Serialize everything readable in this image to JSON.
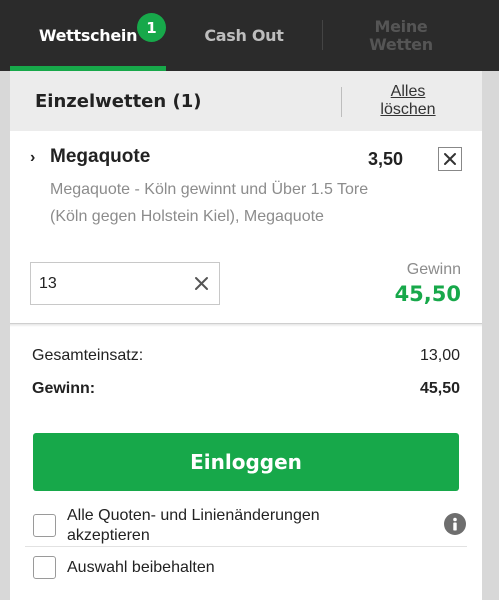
{
  "tabs": {
    "betslip": {
      "label": "Wettschein",
      "badge": "1",
      "active": true
    },
    "cashout": {
      "label": "Cash Out"
    },
    "mybets": {
      "label": "Meine\nWetten"
    }
  },
  "section": {
    "title": "Einzelwetten (1)",
    "clear_all": "Alles\nlöschen"
  },
  "bet": {
    "name": "Megaquote",
    "odds": "3,50",
    "description": "Megaquote - Köln gewinnt und Über 1.5 Tore (Köln gegen Holstein Kiel), Megaquote",
    "stake": "13",
    "win_label": "Gewinn",
    "win_value": "45,50"
  },
  "summary": {
    "total_label": "Gesamteinsatz:",
    "total_value": "13,00",
    "win_label": "Gewinn:",
    "win_value": "45,50"
  },
  "login_button": "Einloggen",
  "options": [
    {
      "label": "Alle Quoten- und Linienänderungen akzeptieren",
      "checked": false
    },
    {
      "label": "Auswahl beibehalten",
      "checked": false
    }
  ],
  "colors": {
    "accent": "#17a84a",
    "tabbar": "#2b2b2b"
  },
  "icons": [
    "chevron-right-icon",
    "close-icon",
    "info-icon"
  ]
}
